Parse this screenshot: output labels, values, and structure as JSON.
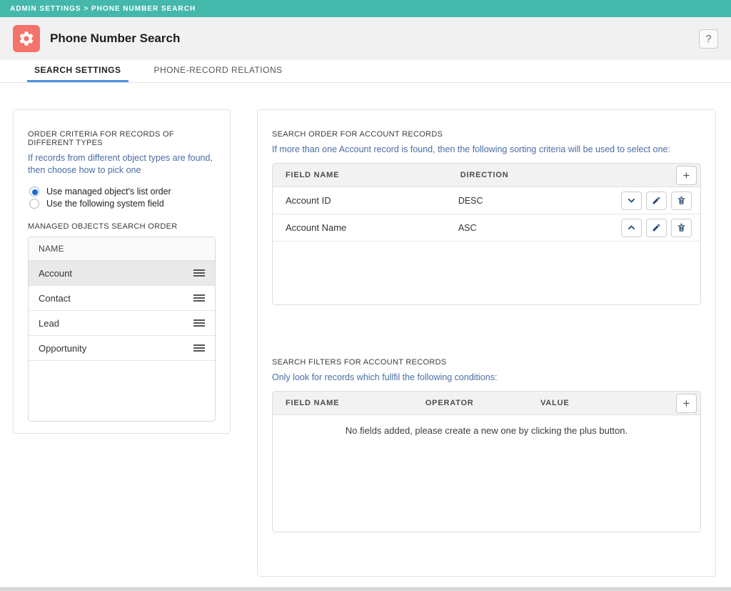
{
  "breadcrumb": "ADMIN SETTINGS > PHONE NUMBER SEARCH",
  "header": {
    "title": "Phone Number Search",
    "help_label": "?"
  },
  "tabs": [
    {
      "label": "SEARCH SETTINGS",
      "active": true
    },
    {
      "label": "PHONE-RECORD RELATIONS",
      "active": false
    }
  ],
  "order_criteria": {
    "title": "ORDER CRITERIA FOR RECORDS OF DIFFERENT TYPES",
    "description": "If records from different object types are found, then choose how to pick one",
    "options": [
      {
        "label": "Use managed object's list order",
        "selected": true
      },
      {
        "label": "Use the following system field",
        "selected": false
      }
    ],
    "managed_objects": {
      "title": "MANAGED OBJECTS SEARCH ORDER",
      "column_header": "NAME",
      "rows": [
        {
          "name": "Account",
          "selected": true
        },
        {
          "name": "Contact",
          "selected": false
        },
        {
          "name": "Lead",
          "selected": false
        },
        {
          "name": "Opportunity",
          "selected": false
        }
      ]
    }
  },
  "search_order": {
    "title": "SEARCH ORDER FOR ACCOUNT RECORDS",
    "description": "If more than one Account record is found, then the following sorting criteria will be used to select one:",
    "columns": [
      "FIELD NAME",
      "DIRECTION"
    ],
    "add_label": "+",
    "rows": [
      {
        "field_name": "Account ID",
        "direction": "DESC",
        "move": "down"
      },
      {
        "field_name": "Account Name",
        "direction": "ASC",
        "move": "up"
      }
    ]
  },
  "search_filters": {
    "title": "SEARCH FILTERS FOR ACCOUNT RECORDS",
    "description": "Only look for records which fullfil the following conditions:",
    "columns": [
      "FIELD NAME",
      "OPERATOR",
      "VALUE"
    ],
    "add_label": "+",
    "empty_message": "No fields added, please create a new one by clicking the plus button."
  },
  "colors": {
    "topbar": "#45b8ac",
    "app_icon": "#f4736b",
    "tab_underline": "#4a90e2",
    "helper_text": "#4a6da5",
    "action_icon": "#24476b"
  }
}
